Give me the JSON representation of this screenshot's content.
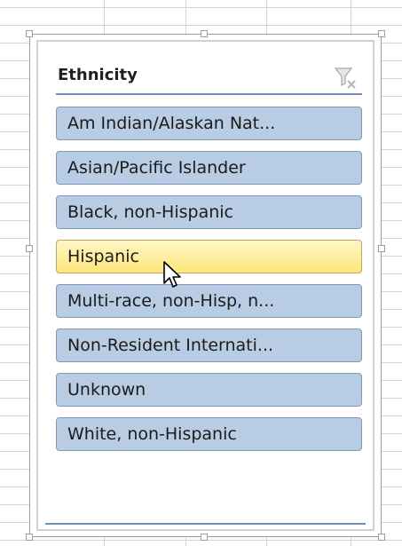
{
  "slicer": {
    "title": "Ethnicity",
    "clear_filter_icon": "clear-filter-icon",
    "items": [
      {
        "label": "Am Indian/Alaskan Nat...",
        "selected": false
      },
      {
        "label": "Asian/Pacific Islander",
        "selected": false
      },
      {
        "label": "Black, non-Hispanic",
        "selected": false
      },
      {
        "label": "Hispanic",
        "selected": true
      },
      {
        "label": "Multi-race, non-Hisp, n...",
        "selected": false
      },
      {
        "label": "Non-Resident Internati...",
        "selected": false
      },
      {
        "label": "Unknown",
        "selected": false
      },
      {
        "label": "White, non-Hispanic",
        "selected": false
      }
    ]
  },
  "colors": {
    "item_fill": "#b8cce4",
    "item_border": "#8199b9",
    "selected_fill": "#fde67a",
    "header_rule": "#6f8fbe",
    "gridline": "#d4d4d4"
  },
  "cursor_icon": "mouse-pointer-icon"
}
